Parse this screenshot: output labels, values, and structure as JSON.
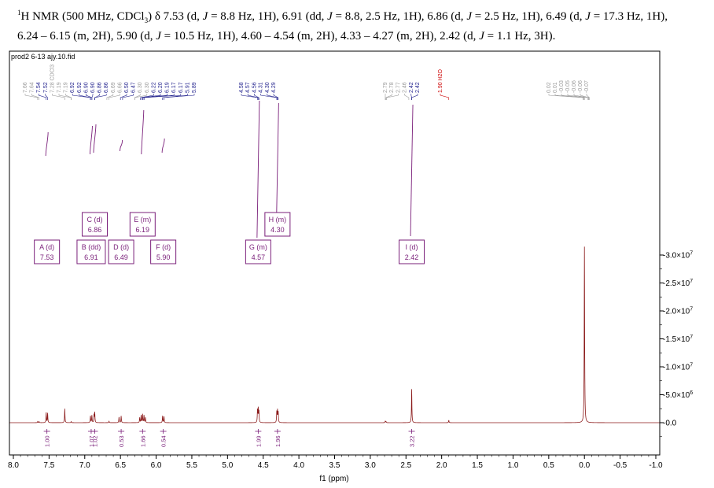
{
  "header": {
    "nucleus_sup": "1",
    "line1_a": "H NMR (500 MHz, CDCl",
    "sub3": "3",
    "line1_b": ") δ 7.53 (d, ",
    "j": "J",
    "line1_c": " = 8.8 Hz, 1H), 6.91 (dd, ",
    "line1_d": " = 8.8, 2.5 Hz, 1H), 6.86 (d, ",
    "line1_e": " = 2.5 Hz, 1H), 6.49 (d, ",
    "line1_f": " = 17.3 Hz, 1H),",
    "line2_a": "6.24 – 6.15 (m, 2H), 5.90 (d, ",
    "line2_b": " = 10.5 Hz, 1H), 4.60 – 4.54 (m, 2H), 4.33 – 4.27 (m, 2H), 2.42 (d, ",
    "line2_c": " = 1.1 Hz, 3H)."
  },
  "chart_data": {
    "type": "line",
    "filename": "prod2 6-13 ajy.10.fid",
    "xlabel": "f1 (ppm)",
    "xlim": [
      8.0,
      -1.0
    ],
    "x_ticks": [
      "8.0",
      "7.5",
      "7.0",
      "6.5",
      "6.0",
      "5.5",
      "5.0",
      "4.5",
      "4.0",
      "3.5",
      "3.0",
      "2.5",
      "2.0",
      "1.5",
      "1.0",
      "0.5",
      "0.0",
      "-0.5",
      "-1.0"
    ],
    "ylim": [
      -3000000,
      32000000
    ],
    "y_ticks": [
      {
        "value": 30000000,
        "mant": "-3.0×10",
        "exp": "7"
      },
      {
        "value": 25000000,
        "mant": "-2.5×10",
        "exp": "7"
      },
      {
        "value": 20000000,
        "mant": "-2.0×10",
        "exp": "7"
      },
      {
        "value": 15000000,
        "mant": "-1.5×10",
        "exp": "7"
      },
      {
        "value": 10000000,
        "mant": "-1.0×10",
        "exp": "7"
      },
      {
        "value": 5000000,
        "mant": "-5.0×10",
        "exp": "6"
      },
      {
        "value": 0,
        "mant": "-0.0",
        "exp": ""
      }
    ],
    "colors": {
      "spectrum": "#8b1a1a",
      "integral": "#7a1f7a",
      "peak_dark": "#1f1f8c",
      "peak_light": "#9a9a9a",
      "h2o": "#cc0000"
    },
    "peaks": [
      {
        "ppm": 7.66,
        "height": 200000
      },
      {
        "ppm": 7.64,
        "height": 200000
      },
      {
        "ppm": 7.54,
        "height": 1800000
      },
      {
        "ppm": 7.52,
        "height": 1700000
      },
      {
        "ppm": 7.28,
        "height": 2500000
      },
      {
        "ppm": 7.19,
        "height": 200000
      },
      {
        "ppm": 6.92,
        "height": 1200000
      },
      {
        "ppm": 6.9,
        "height": 1300000
      },
      {
        "ppm": 6.87,
        "height": 1400000
      },
      {
        "ppm": 6.86,
        "height": 1800000
      },
      {
        "ppm": 6.66,
        "height": 250000
      },
      {
        "ppm": 6.52,
        "height": 1000000
      },
      {
        "ppm": 6.49,
        "height": 1200000
      },
      {
        "ppm": 6.23,
        "height": 900000
      },
      {
        "ppm": 6.21,
        "height": 1300000
      },
      {
        "ppm": 6.19,
        "height": 1500000
      },
      {
        "ppm": 6.17,
        "height": 1300000
      },
      {
        "ppm": 6.15,
        "height": 900000
      },
      {
        "ppm": 5.91,
        "height": 1200000
      },
      {
        "ppm": 5.89,
        "height": 1100000
      },
      {
        "ppm": 4.58,
        "height": 2200000
      },
      {
        "ppm": 4.57,
        "height": 2400000
      },
      {
        "ppm": 4.56,
        "height": 2000000
      },
      {
        "ppm": 4.31,
        "height": 1900000
      },
      {
        "ppm": 4.3,
        "height": 2100000
      },
      {
        "ppm": 4.29,
        "height": 1800000
      },
      {
        "ppm": 2.79,
        "height": 250000
      },
      {
        "ppm": 2.78,
        "height": 200000
      },
      {
        "ppm": 2.42,
        "height": 6000000
      },
      {
        "ppm": 1.9,
        "height": 450000
      },
      {
        "ppm": 0.0,
        "height": 31500000
      }
    ],
    "peak_labels": [
      {
        "ppm": 7.66,
        "text": "7.66",
        "dark": false
      },
      {
        "ppm": 7.64,
        "text": "7.64",
        "dark": false
      },
      {
        "ppm": 7.54,
        "text": "7.54",
        "dark": true
      },
      {
        "ppm": 7.52,
        "text": "7.52",
        "dark": true
      },
      {
        "ppm": 7.28,
        "text": "7.28 CDCl3",
        "dark": false
      },
      {
        "ppm": 7.19,
        "text": "7.19",
        "dark": false
      },
      {
        "ppm": 7.19,
        "text": "7.19",
        "dark": false
      },
      {
        "ppm": 6.92,
        "text": "6.92",
        "dark": true
      },
      {
        "ppm": 6.92,
        "text": "6.92",
        "dark": true
      },
      {
        "ppm": 6.9,
        "text": "6.90",
        "dark": true
      },
      {
        "ppm": 6.9,
        "text": "6.90",
        "dark": true
      },
      {
        "ppm": 6.86,
        "text": "6.86",
        "dark": true
      },
      {
        "ppm": 6.86,
        "text": "6.86",
        "dark": true
      },
      {
        "ppm": 6.69,
        "text": "6.69",
        "dark": false
      },
      {
        "ppm": 6.66,
        "text": "6.66",
        "dark": false
      },
      {
        "ppm": 6.5,
        "text": "6.50",
        "dark": true
      },
      {
        "ppm": 6.47,
        "text": "6.47",
        "dark": true
      },
      {
        "ppm": 6.3,
        "text": "6.30",
        "dark": false
      },
      {
        "ppm": 6.3,
        "text": "6.30",
        "dark": false
      },
      {
        "ppm": 6.22,
        "text": "6.22",
        "dark": true
      },
      {
        "ppm": 6.2,
        "text": "6.20",
        "dark": true
      },
      {
        "ppm": 6.19,
        "text": "6.19",
        "dark": true
      },
      {
        "ppm": 6.17,
        "text": "6.17",
        "dark": true
      },
      {
        "ppm": 6.17,
        "text": "6.17",
        "dark": true
      },
      {
        "ppm": 5.91,
        "text": "5.91",
        "dark": true
      },
      {
        "ppm": 5.89,
        "text": "5.89",
        "dark": true
      },
      {
        "ppm": 4.58,
        "text": "4.58",
        "dark": true
      },
      {
        "ppm": 4.57,
        "text": "4.57",
        "dark": true
      },
      {
        "ppm": 4.56,
        "text": "4.56",
        "dark": true
      },
      {
        "ppm": 4.31,
        "text": "4.31",
        "dark": true
      },
      {
        "ppm": 4.3,
        "text": "4.30",
        "dark": true
      },
      {
        "ppm": 4.29,
        "text": "4.29",
        "dark": true
      },
      {
        "ppm": 2.79,
        "text": "2.79",
        "dark": false
      },
      {
        "ppm": 2.78,
        "text": "2.78",
        "dark": false
      },
      {
        "ppm": 2.77,
        "text": "2.77",
        "dark": false
      },
      {
        "ppm": 2.46,
        "text": "2.46",
        "dark": false
      },
      {
        "ppm": 2.42,
        "text": "2.42",
        "dark": true
      },
      {
        "ppm": 2.42,
        "text": "2.42",
        "dark": true
      },
      {
        "ppm": 1.9,
        "text": "1.90 H2O",
        "dark": false,
        "red": true
      },
      {
        "ppm": 0.02,
        "text": "0.02",
        "dark": false
      },
      {
        "ppm": 0.01,
        "text": "0.01",
        "dark": false
      },
      {
        "ppm": 0.0,
        "text": "-0.03",
        "dark": false
      },
      {
        "ppm": -0.05,
        "text": "-0.05",
        "dark": false
      },
      {
        "ppm": -0.06,
        "text": "-0.06",
        "dark": false
      },
      {
        "ppm": -0.06,
        "text": "-0.06",
        "dark": false
      },
      {
        "ppm": -0.07,
        "text": "-0.07",
        "dark": false
      }
    ],
    "multiplets": [
      {
        "letter": "A (d)",
        "shift": "7.53",
        "ppm": 7.53,
        "row": 2
      },
      {
        "letter": "B (dd)",
        "shift": "6.91",
        "ppm": 6.91,
        "row": 2
      },
      {
        "letter": "C (d)",
        "shift": "6.86",
        "ppm": 6.86,
        "row": 1
      },
      {
        "letter": "D (d)",
        "shift": "6.49",
        "ppm": 6.49,
        "row": 2
      },
      {
        "letter": "E (m)",
        "shift": "6.19",
        "ppm": 6.19,
        "row": 1
      },
      {
        "letter": "F (d)",
        "shift": "5.90",
        "ppm": 5.9,
        "row": 2
      },
      {
        "letter": "G (m)",
        "shift": "4.57",
        "ppm": 4.57,
        "row": 2
      },
      {
        "letter": "H (m)",
        "shift": "4.30",
        "ppm": 4.3,
        "row": 1
      },
      {
        "letter": "I (d)",
        "shift": "2.42",
        "ppm": 2.42,
        "row": 2
      }
    ],
    "integrals": [
      {
        "ppm": 7.53,
        "value": "1.00"
      },
      {
        "ppm": 6.91,
        "value": "1.07"
      },
      {
        "ppm": 6.86,
        "value": "1.02"
      },
      {
        "ppm": 6.49,
        "value": "0.53"
      },
      {
        "ppm": 6.19,
        "value": "1.66"
      },
      {
        "ppm": 5.9,
        "value": "0.54"
      },
      {
        "ppm": 4.57,
        "value": "1.99"
      },
      {
        "ppm": 4.3,
        "value": "1.96"
      },
      {
        "ppm": 2.42,
        "value": "3.22"
      }
    ]
  }
}
